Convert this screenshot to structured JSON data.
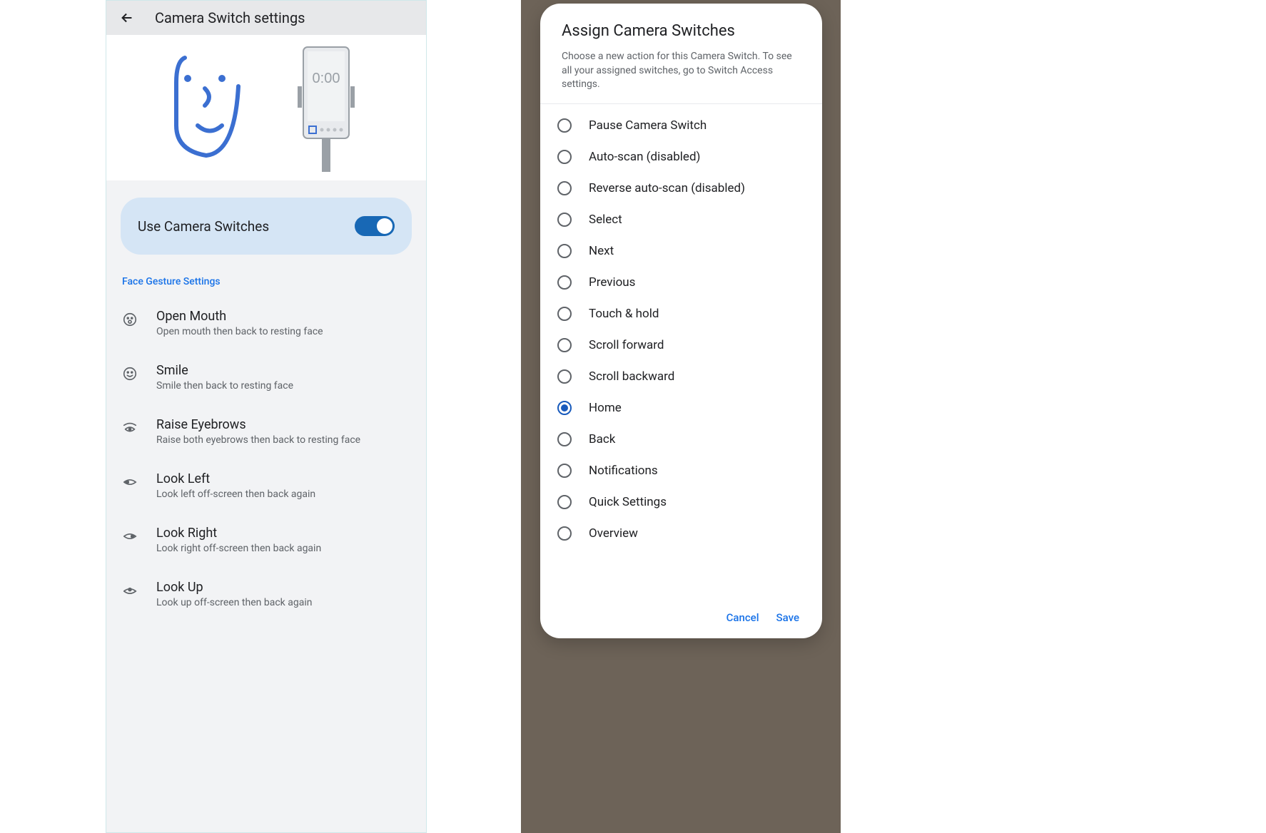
{
  "left": {
    "title": "Camera Switch settings",
    "toggle_label": "Use Camera Switches",
    "toggle_on": true,
    "section_label": "Face Gesture Settings",
    "hero_time": "0:00",
    "gestures": [
      {
        "icon": "open-mouth",
        "title": "Open Mouth",
        "desc": "Open mouth then back to resting face"
      },
      {
        "icon": "smile",
        "title": "Smile",
        "desc": "Smile then back to resting face"
      },
      {
        "icon": "raise-eyebrows",
        "title": "Raise Eyebrows",
        "desc": "Raise both eyebrows then back to resting face"
      },
      {
        "icon": "look-left",
        "title": "Look Left",
        "desc": "Look left off-screen then back again"
      },
      {
        "icon": "look-right",
        "title": "Look Right",
        "desc": "Look right off-screen then back again"
      },
      {
        "icon": "look-up",
        "title": "Look Up",
        "desc": "Look up off-screen then back again"
      }
    ]
  },
  "right": {
    "dialog_title": "Assign Camera Switches",
    "dialog_desc": "Choose a new action for this Camera Switch. To see all your assigned switches, go to Switch Access settings.",
    "options": [
      {
        "label": "Pause Camera Switch",
        "selected": false
      },
      {
        "label": "Auto-scan (disabled)",
        "selected": false
      },
      {
        "label": "Reverse auto-scan (disabled)",
        "selected": false
      },
      {
        "label": "Select",
        "selected": false
      },
      {
        "label": "Next",
        "selected": false
      },
      {
        "label": "Previous",
        "selected": false
      },
      {
        "label": "Touch & hold",
        "selected": false
      },
      {
        "label": "Scroll forward",
        "selected": false
      },
      {
        "label": "Scroll backward",
        "selected": false
      },
      {
        "label": "Home",
        "selected": true
      },
      {
        "label": "Back",
        "selected": false
      },
      {
        "label": "Notifications",
        "selected": false
      },
      {
        "label": "Quick Settings",
        "selected": false
      },
      {
        "label": "Overview",
        "selected": false
      }
    ],
    "cancel": "Cancel",
    "save": "Save"
  }
}
